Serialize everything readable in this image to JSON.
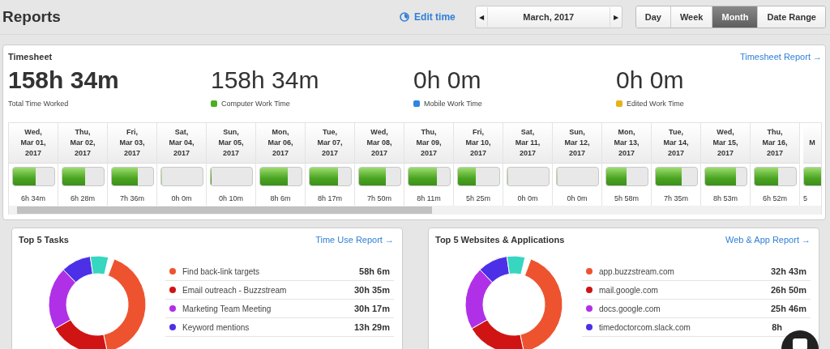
{
  "header": {
    "title": "Reports",
    "edit_time": "Edit time",
    "period": "March, 2017",
    "prev": "◀",
    "next": "▶",
    "ranges": [
      {
        "label": "Day",
        "selected": false
      },
      {
        "label": "Week",
        "selected": false
      },
      {
        "label": "Month",
        "selected": true
      },
      {
        "label": "Date Range",
        "selected": false
      }
    ]
  },
  "timesheet": {
    "title": "Timesheet",
    "link": "Timesheet Report →",
    "stats": [
      {
        "value": "158h 34m",
        "label": "Total Time Worked",
        "kind": "total"
      },
      {
        "value": "158h 34m",
        "label": "Computer Work Time",
        "kind": "legend",
        "color": "#4caf1f"
      },
      {
        "value": "0h 0m",
        "label": "Mobile Work Time",
        "kind": "legend",
        "color": "#2f86e0"
      },
      {
        "value": "0h 0m",
        "label": "Edited Work Time",
        "kind": "legend",
        "color": "#e6b21a"
      }
    ],
    "days": [
      {
        "header": [
          "Wed,",
          "Mar 01,",
          "2017"
        ],
        "level": 0.55,
        "hours": "6h 34m"
      },
      {
        "header": [
          "Thu,",
          "Mar 02,",
          "2017"
        ],
        "level": 0.55,
        "hours": "6h 28m"
      },
      {
        "header": [
          "Fri,",
          "Mar 03,",
          "2017"
        ],
        "level": 0.63,
        "hours": "7h 36m"
      },
      {
        "header": [
          "Sat,",
          "Mar 04,",
          "2017"
        ],
        "level": 0,
        "hours": "0h 0m"
      },
      {
        "header": [
          "Sun,",
          "Mar 05,",
          "2017"
        ],
        "level": 0.03,
        "hours": "0h 10m"
      },
      {
        "header": [
          "Mon,",
          "Mar 06,",
          "2017"
        ],
        "level": 0.68,
        "hours": "8h 6m"
      },
      {
        "header": [
          "Tue,",
          "Mar 07,",
          "2017"
        ],
        "level": 0.7,
        "hours": "8h 17m"
      },
      {
        "header": [
          "Wed,",
          "Mar 08,",
          "2017"
        ],
        "level": 0.66,
        "hours": "7h 50m"
      },
      {
        "header": [
          "Thu,",
          "Mar 09,",
          "2017"
        ],
        "level": 0.69,
        "hours": "8h 11m"
      },
      {
        "header": [
          "Fri,",
          "Mar 10,",
          "2017"
        ],
        "level": 0.45,
        "hours": "5h 25m"
      },
      {
        "header": [
          "Sat,",
          "Mar 11,",
          "2017"
        ],
        "level": 0,
        "hours": "0h 0m"
      },
      {
        "header": [
          "Sun,",
          "Mar 12,",
          "2017"
        ],
        "level": 0,
        "hours": "0h 0m"
      },
      {
        "header": [
          "Mon,",
          "Mar 13,",
          "2017"
        ],
        "level": 0.5,
        "hours": "5h 58m"
      },
      {
        "header": [
          "Tue,",
          "Mar 14,",
          "2017"
        ],
        "level": 0.63,
        "hours": "7h 35m"
      },
      {
        "header": [
          "Wed,",
          "Mar 15,",
          "2017"
        ],
        "level": 0.75,
        "hours": "8h 53m"
      },
      {
        "header": [
          "Thu,",
          "Mar 16,",
          "2017"
        ],
        "level": 0.58,
        "hours": "6h 52m"
      },
      {
        "header": [
          "M"
        ],
        "level": 1,
        "hours": "5"
      }
    ]
  },
  "panels": [
    {
      "title": "Top 5 Tasks",
      "link": "Time Use Report →",
      "items": [
        {
          "name": "Find back-link targets",
          "time": "58h 6m",
          "color": "#ee5330"
        },
        {
          "name": "Email outreach - Buzzstream",
          "time": "30h 35m",
          "color": "#d01414"
        },
        {
          "name": "Marketing Team Meeting",
          "time": "30h 17m",
          "color": "#b030e8"
        },
        {
          "name": "Keyword mentions",
          "time": "13h 29m",
          "color": "#4c30e8"
        }
      ]
    },
    {
      "title": "Top 5 Websites & Applications",
      "link": "Web & App Report →",
      "items": [
        {
          "name": "app.buzzstream.com",
          "time": "32h 43m",
          "color": "#ee5330"
        },
        {
          "name": "mail.google.com",
          "time": "26h 50m",
          "color": "#d01414"
        },
        {
          "name": "docs.google.com",
          "time": "25h 46m",
          "color": "#b030e8"
        },
        {
          "name": "timedoctorcom.slack.com",
          "time": "8h",
          "color": "#4c30e8"
        }
      ]
    }
  ]
}
